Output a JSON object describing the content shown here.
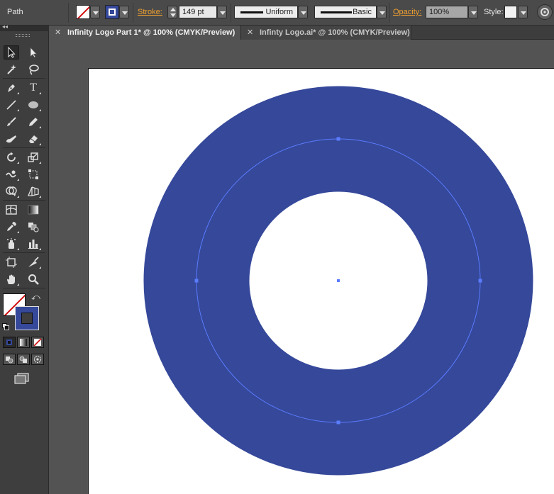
{
  "control_bar": {
    "selection_type": "Path",
    "stroke_label": "Stroke:",
    "stroke_weight": "149 pt",
    "stroke_profile": "Uniform",
    "brush_definition": "Basic",
    "opacity_label": "Opacity:",
    "opacity_value": "100%",
    "style_label": "Style:"
  },
  "tabs": [
    {
      "label": "Infinity Logo Part 1* @ 100% (CMYK/Preview)",
      "active": true
    },
    {
      "label": "Infinty Logo.ai* @ 100% (CMYK/Preview)",
      "active": false
    }
  ],
  "tools": [
    "selection-tool",
    "direct-selection-tool",
    "magic-wand-tool",
    "lasso-tool",
    "pen-tool",
    "type-tool",
    "line-segment-tool",
    "ellipse-tool",
    "paintbrush-tool",
    "pencil-tool",
    "blob-brush-tool",
    "eraser-tool",
    "rotate-tool",
    "scale-tool",
    "warp-tool",
    "free-transform-tool",
    "shape-builder-tool",
    "perspective-grid-tool",
    "mesh-tool",
    "gradient-tool",
    "eyedropper-tool",
    "blend-tool",
    "symbol-sprayer-tool",
    "column-graph-tool",
    "artboard-tool",
    "slice-tool",
    "hand-tool",
    "zoom-tool"
  ],
  "colors": {
    "stroke_blue": "#35489a",
    "path_highlight": "#5b7cff",
    "artboard": "#ffffff",
    "ui_accent": "#f0a030"
  }
}
